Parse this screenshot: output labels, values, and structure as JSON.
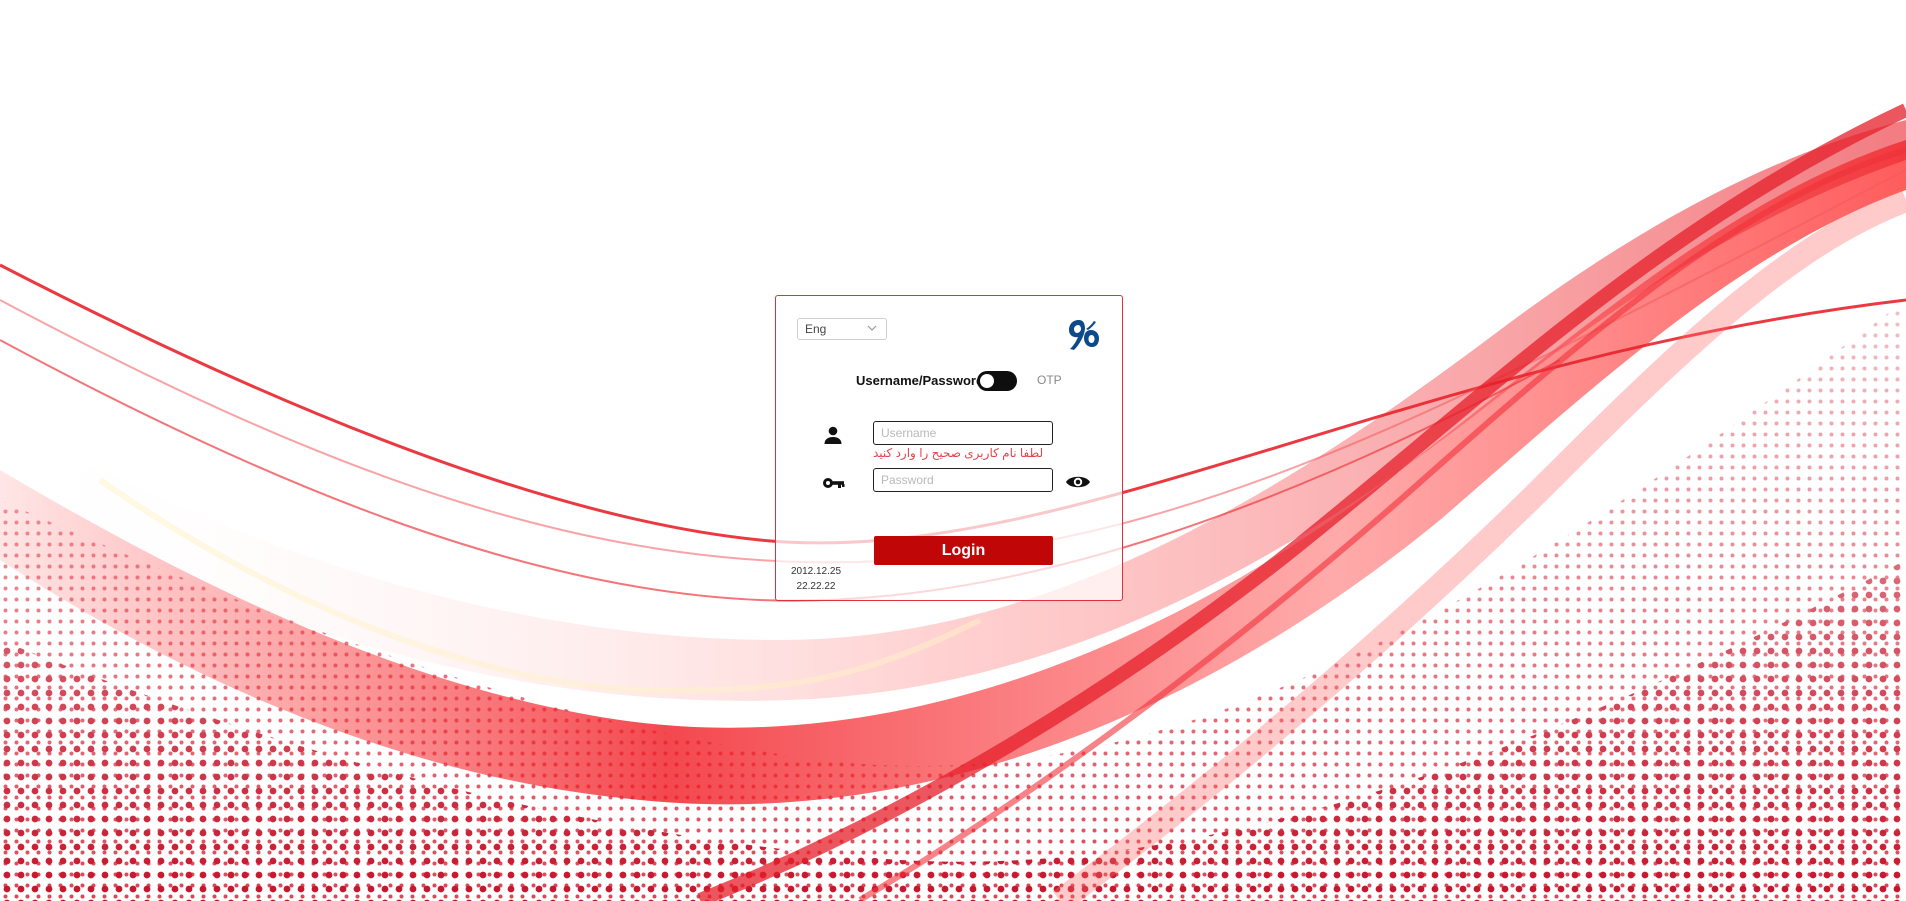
{
  "colors": {
    "accent": "#c10608",
    "card_border": "#e0303a",
    "error_text": "#e2454d",
    "wave_red": "#e8232c",
    "dots_red": "#c4142a"
  },
  "language": {
    "selected": "Eng",
    "icon": "chevron-down-icon"
  },
  "brand": {
    "logo": "brand-logo-icon"
  },
  "auth_mode": {
    "left_label": "Username/Password",
    "right_label": "OTP",
    "toggle_on": false
  },
  "username": {
    "placeholder": "Username",
    "value": "",
    "icon": "user-icon",
    "error": "لطفا نام کاربری صحیح را وارد کنید"
  },
  "password": {
    "placeholder": "Password",
    "value": "",
    "icon": "key-icon",
    "toggle_icon": "eye-icon"
  },
  "login_button": {
    "label": "Login"
  },
  "stamp": {
    "date": "2012.12.25",
    "time": "22.22.22"
  }
}
